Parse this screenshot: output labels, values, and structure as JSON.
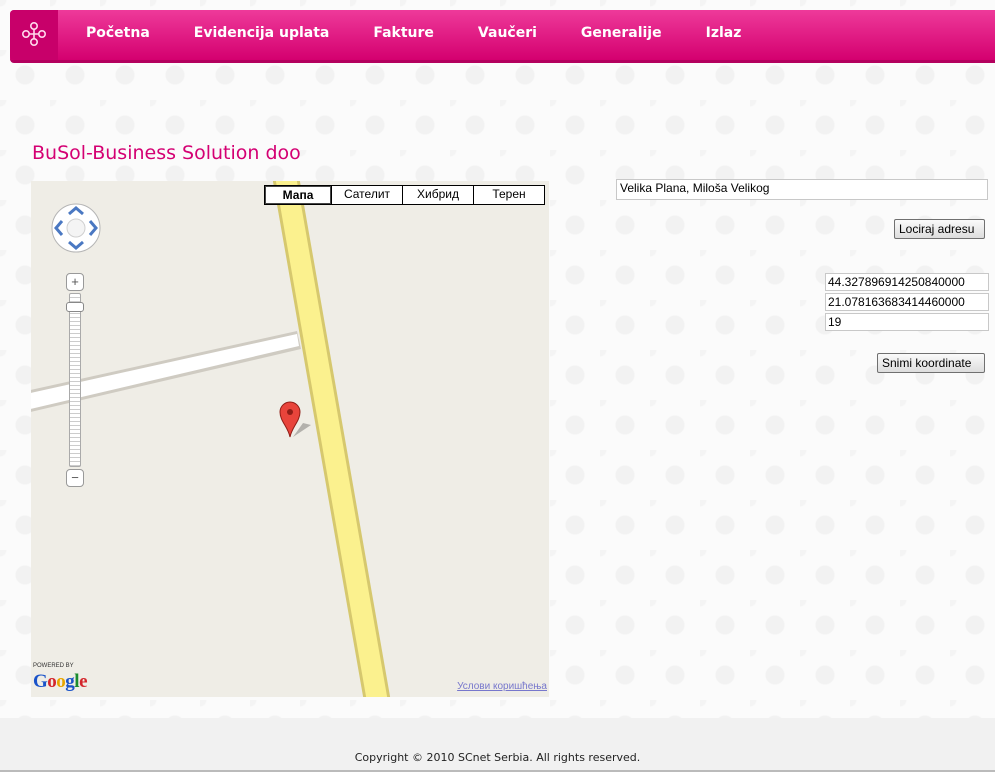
{
  "nav": {
    "items": [
      "Početna",
      "Evidencija uplata",
      "Fakture",
      "Vaučeri",
      "Generalije",
      "Izlaz"
    ]
  },
  "company_name": "BuSol-Business Solution doo",
  "map": {
    "types": [
      "Мапа",
      "Сателит",
      "Хибрид",
      "Терен"
    ],
    "active_type": "Мапа",
    "powered_by": "POWERED BY",
    "provider": "Google",
    "terms": "Услови коришћења"
  },
  "form": {
    "address_value": "Velika Plana, Miloša Velikog",
    "locate_label": "Lociraj adresu",
    "latitude": "44.327896914250840000",
    "longitude": "21.078163683414460000",
    "zoom": "19",
    "save_label": "Snimi koordinate"
  },
  "footer": {
    "copyright": "Copyright © 2010 SCnet Serbia. All rights reserved."
  },
  "colors": {
    "brand_pink": "#d4006f",
    "title_pink": "#d40073"
  }
}
